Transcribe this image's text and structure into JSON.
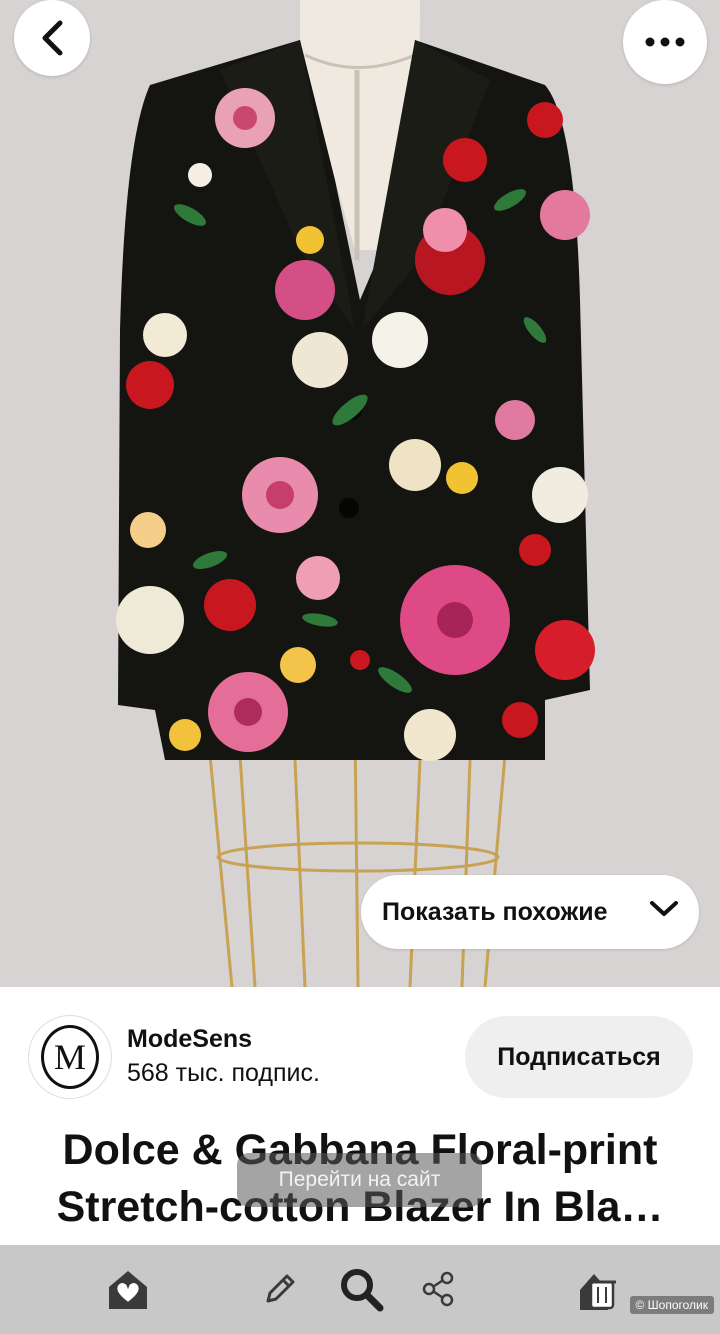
{
  "pin": {
    "image_alt": "Dolce & Gabbana floral-print blazer on dress form",
    "show_similar_label": "Показать похожие"
  },
  "header": {
    "back_icon": "chevron-left-icon",
    "more_icon": "ellipsis-icon"
  },
  "author": {
    "avatar_letter": "M",
    "name": "ModeSens",
    "followers": "568 тыс. подпис.",
    "subscribe_label": "Подписаться"
  },
  "title": {
    "line1": "Dolce & Gabbana Floral-print",
    "line2": "Stretch-cotton Blazer In Bla…"
  },
  "overlay": {
    "visit_label": "Перейти на сайт"
  },
  "bottom_bar": {
    "items": [
      "home-heart-icon",
      "pencil-icon",
      "search-icon",
      "share-icon",
      "trash-icon"
    ]
  },
  "watermark": "© Шопоголик",
  "colors": {
    "photo_background": "#d6d3d2",
    "bar_background": "#c8c8c8",
    "button_gray": "#efefef"
  }
}
